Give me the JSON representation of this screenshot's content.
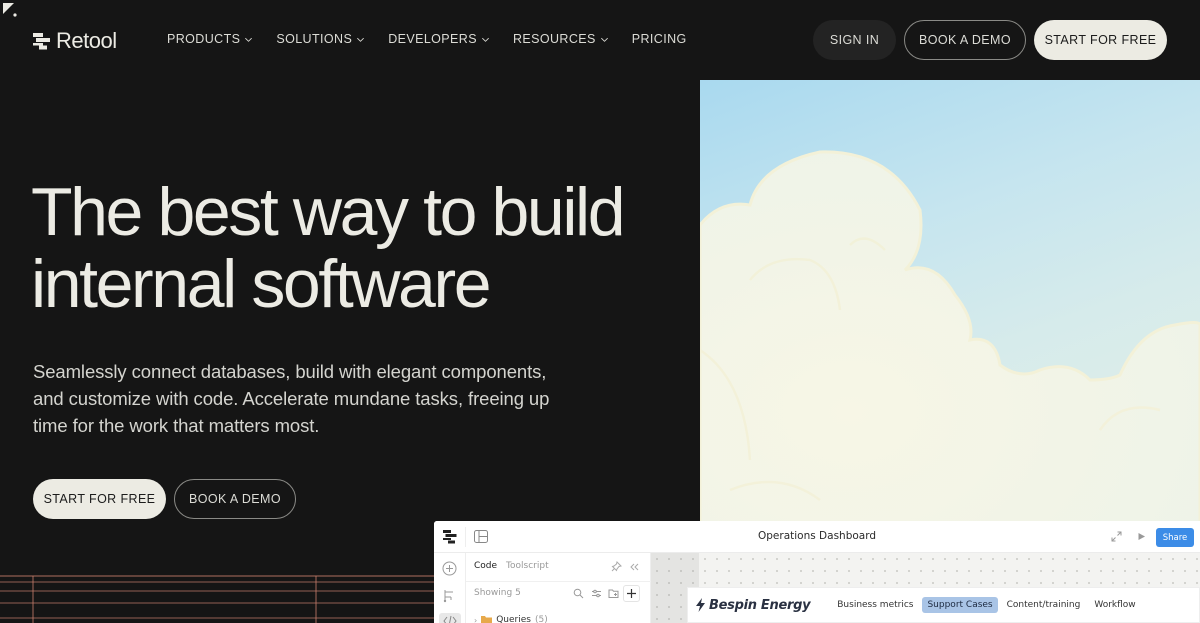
{
  "nav": {
    "brand": "Retool",
    "links": [
      {
        "label": "PRODUCTS",
        "has_dropdown": true
      },
      {
        "label": "SOLUTIONS",
        "has_dropdown": true
      },
      {
        "label": "DEVELOPERS",
        "has_dropdown": true
      },
      {
        "label": "RESOURCES",
        "has_dropdown": true
      },
      {
        "label": "PRICING",
        "has_dropdown": false
      }
    ],
    "sign_in": "SIGN IN",
    "book_demo": "BOOK A DEMO",
    "start_free": "START FOR FREE"
  },
  "hero": {
    "title_line1": "The best way to build",
    "title_line2": "internal software",
    "subtitle": "Seamlessly connect databases, build with elegant components, and customize with code. Accelerate mundane tasks, freeing up time for the work that matters most.",
    "primary_cta": "START FOR FREE",
    "secondary_cta": "BOOK A DEMO"
  },
  "app_preview": {
    "title": "Operations Dashboard",
    "share_label": "Share",
    "code_panel": {
      "tabs": [
        "Code",
        "Toolscript"
      ],
      "active_tab": "Code",
      "showing": "Showing 5",
      "folder_label": "Queries",
      "folder_count": "(5)"
    },
    "app_header": {
      "brand": "Bespin Energy",
      "nav": [
        {
          "label": "Business metrics",
          "active": false
        },
        {
          "label": "Support Cases",
          "active": true
        },
        {
          "label": "Content/training",
          "active": false
        },
        {
          "label": "Workflow",
          "active": false
        }
      ]
    }
  },
  "colors": {
    "background": "#151515",
    "text": "#ecebe4",
    "primary_button": "#ecebe3",
    "share_button": "#3c8ce7",
    "active_nav": "#a9c4e6",
    "grid_lines": "#c97e6c"
  }
}
